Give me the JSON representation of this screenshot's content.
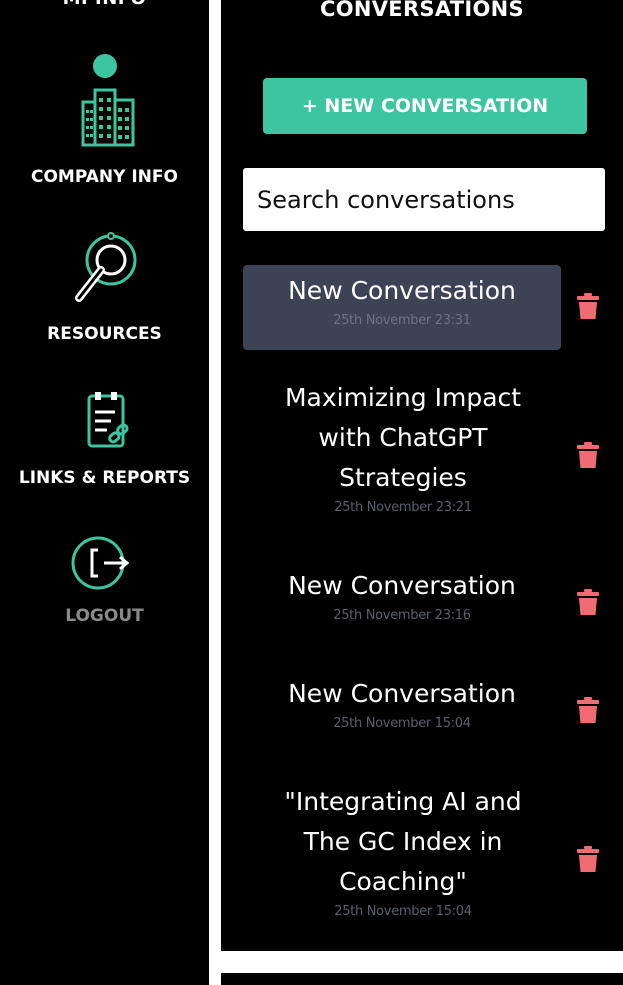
{
  "sidebar": {
    "top_cutoff_label": "MI INFO",
    "items": [
      {
        "label": "COMPANY INFO",
        "icon": "building-icon"
      },
      {
        "label": "RESOURCES",
        "icon": "magnifier-icon"
      },
      {
        "label": "LINKS & REPORTS",
        "icon": "clipboard-link-icon"
      },
      {
        "label": "LOGOUT",
        "icon": "logout-icon"
      }
    ]
  },
  "conversations": {
    "title": "CONVERSATIONS",
    "new_button_label": "+ NEW CONVERSATION",
    "search_placeholder": "Search conversations",
    "items": [
      {
        "title": "New Conversation",
        "time": "25th November 23:31",
        "active": true
      },
      {
        "title": "Maximizing Impact with ChatGPT Strategies",
        "time": "25th November 23:21"
      },
      {
        "title": "New Conversation",
        "time": "25th November 23:16"
      },
      {
        "title": "New Conversation",
        "time": "25th November 15:04"
      },
      {
        "title": "\"Integrating AI and The GC Index in Coaching\"",
        "time": "25th November 15:04"
      }
    ]
  },
  "colors": {
    "accent": "#3dc5a0",
    "delete": "#f06c72",
    "active_item_bg": "#3b4354"
  }
}
